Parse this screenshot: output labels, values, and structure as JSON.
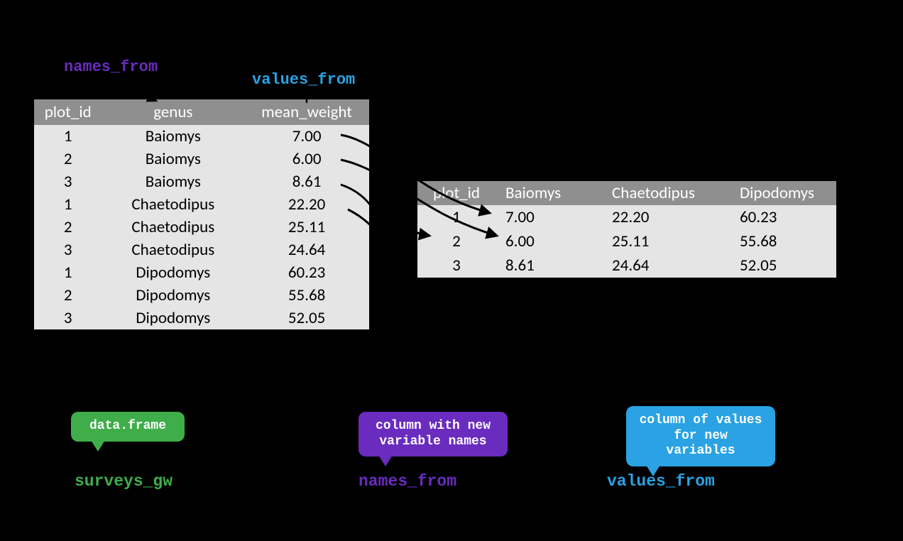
{
  "labels": {
    "names_from": "names_from",
    "values_from": "values_from"
  },
  "long_table": {
    "headers": [
      "plot_id",
      "genus",
      "mean_weight"
    ],
    "rows": [
      {
        "plot_id": "1",
        "genus": "Baiomys",
        "mean_weight": "7.00"
      },
      {
        "plot_id": "2",
        "genus": "Baiomys",
        "mean_weight": "6.00"
      },
      {
        "plot_id": "3",
        "genus": "Baiomys",
        "mean_weight": "8.61"
      },
      {
        "plot_id": "1",
        "genus": "Chaetodipus",
        "mean_weight": "22.20"
      },
      {
        "plot_id": "2",
        "genus": "Chaetodipus",
        "mean_weight": "25.11"
      },
      {
        "plot_id": "3",
        "genus": "Chaetodipus",
        "mean_weight": "24.64"
      },
      {
        "plot_id": "1",
        "genus": "Dipodomys",
        "mean_weight": "60.23"
      },
      {
        "plot_id": "2",
        "genus": "Dipodomys",
        "mean_weight": "55.68"
      },
      {
        "plot_id": "3",
        "genus": "Dipodomys",
        "mean_weight": "52.05"
      }
    ]
  },
  "wide_table": {
    "headers": [
      "plot_id",
      "Baiomys",
      "Chaetodipus",
      "Dipodomys"
    ],
    "rows": [
      {
        "plot_id": "1",
        "Baiomys": "7.00",
        "Chaetodipus": "22.20",
        "Dipodomys": "60.23"
      },
      {
        "plot_id": "2",
        "Baiomys": "6.00",
        "Chaetodipus": "25.11",
        "Dipodomys": "55.68"
      },
      {
        "plot_id": "3",
        "Baiomys": "8.61",
        "Chaetodipus": "24.64",
        "Dipodomys": "52.05"
      }
    ]
  },
  "bubbles": {
    "green": "data.frame",
    "purple": "column with new variable names",
    "blue": "column of values for new variables"
  },
  "bottom": {
    "green": "surveys_gw",
    "purple": "names_from",
    "blue": "values_from"
  }
}
